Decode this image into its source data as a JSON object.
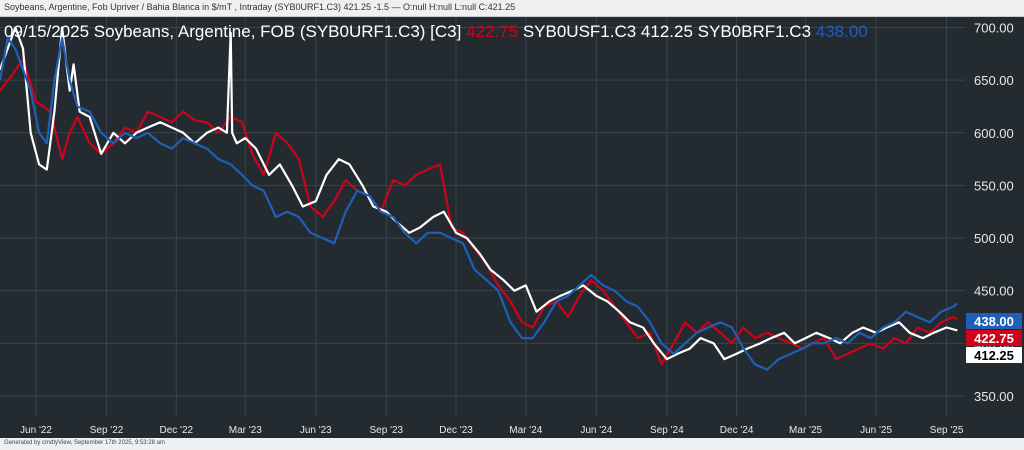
{
  "top_bar": {
    "text": "Soybeans, Argentine, Fob Upriver / Bahia Blanca in $/mT , Intraday (SYB0URF1.C3) 421.25 -1.5 — O:null H:null L:null C:421.25"
  },
  "footer": {
    "text": "Generated by cmdtyView, September 17th 2025, 9:53:28 am"
  },
  "colors": {
    "background": "#232b30",
    "red": "#d0021b",
    "white": "#ffffff",
    "blue": "#1f5fb8",
    "axis_text": "#e8e8e8",
    "grid": "#3a444b"
  },
  "chart_data": {
    "type": "line",
    "title": "09/15/2025 Soybeans, Argentine, FOB (SYB0URF1.C3) [C3]",
    "legend": [
      {
        "label": "422.75",
        "color": "#d0021b"
      },
      {
        "label": "SYB0USF1.C3 412.25",
        "color": "#ffffff"
      },
      {
        "label": "SYB0BRF1.C3",
        "color": "#ffffff"
      },
      {
        "label": "438.00",
        "color": "#1f5fb8"
      }
    ],
    "x_ticks": [
      "Jun '22",
      "Sep '22",
      "Dec '22",
      "Mar '23",
      "Jun '23",
      "Sep '23",
      "Dec '23",
      "Mar '24",
      "Jun '24",
      "Sep '24",
      "Dec '24",
      "Mar '25",
      "Jun '25",
      "Sep '25"
    ],
    "y_ticks": [
      350,
      400,
      450,
      500,
      550,
      600,
      650,
      700
    ],
    "ylim": [
      330,
      710
    ],
    "xlim": [
      "2022-04-15",
      "2025-09-25"
    ],
    "end_labels": [
      {
        "label": "438.00",
        "value": 438.0,
        "color": "#1f5fb8",
        "text_color": "#ffffff"
      },
      {
        "label": "422.75",
        "value": 422.75,
        "color": "#d0021b",
        "text_color": "#ffffff"
      },
      {
        "label": "412.25",
        "value": 412.25,
        "color": "#ffffff",
        "text_color": "#000000"
      }
    ],
    "series": [
      {
        "color": "#d0021b",
        "x": [
          "2022-04-15",
          "2022-05-01",
          "2022-05-15",
          "2022-06-01",
          "2022-06-20",
          "2022-07-05",
          "2022-07-15",
          "2022-07-25",
          "2022-08-10",
          "2022-08-25",
          "2022-09-10",
          "2022-09-25",
          "2022-10-10",
          "2022-10-25",
          "2022-11-10",
          "2022-11-25",
          "2022-12-10",
          "2022-12-25",
          "2023-01-10",
          "2023-01-25",
          "2023-02-10",
          "2023-02-25",
          "2023-03-10",
          "2023-03-25",
          "2023-04-10",
          "2023-04-25",
          "2023-05-10",
          "2023-05-25",
          "2023-06-10",
          "2023-06-25",
          "2023-07-10",
          "2023-07-25",
          "2023-08-10",
          "2023-08-25",
          "2023-09-10",
          "2023-09-25",
          "2023-10-10",
          "2023-10-25",
          "2023-11-10",
          "2023-11-25",
          "2023-12-10",
          "2023-12-25",
          "2024-01-10",
          "2024-01-25",
          "2024-02-10",
          "2024-02-25",
          "2024-03-10",
          "2024-03-25",
          "2024-04-10",
          "2024-04-25",
          "2024-05-10",
          "2024-05-25",
          "2024-06-10",
          "2024-06-25",
          "2024-07-10",
          "2024-07-25",
          "2024-08-10",
          "2024-08-25",
          "2024-09-10",
          "2024-09-25",
          "2024-10-10",
          "2024-10-25",
          "2024-11-10",
          "2024-11-25",
          "2024-12-10",
          "2024-12-25",
          "2025-01-10",
          "2025-01-25",
          "2025-02-10",
          "2025-02-25",
          "2025-03-10",
          "2025-03-25",
          "2025-04-10",
          "2025-04-25",
          "2025-05-10",
          "2025-05-25",
          "2025-06-10",
          "2025-06-25",
          "2025-07-10",
          "2025-07-25",
          "2025-08-10",
          "2025-08-25",
          "2025-09-10",
          "2025-09-15"
        ],
        "y": [
          640,
          655,
          670,
          630,
          620,
          575,
          600,
          615,
          590,
          580,
          590,
          605,
          600,
          620,
          615,
          610,
          620,
          612,
          610,
          600,
          615,
          610,
          580,
          560,
          600,
          590,
          575,
          530,
          520,
          535,
          555,
          545,
          540,
          525,
          555,
          550,
          560,
          565,
          570,
          510,
          505,
          490,
          475,
          455,
          440,
          420,
          415,
          435,
          440,
          425,
          445,
          460,
          450,
          435,
          420,
          405,
          410,
          380,
          400,
          420,
          410,
          420,
          410,
          400,
          415,
          405,
          410,
          405,
          400,
          395,
          400,
          405,
          385,
          390,
          395,
          400,
          395,
          405,
          400,
          415,
          410,
          420,
          425,
          422.75
        ]
      },
      {
        "color": "#ffffff",
        "x": [
          "2022-04-15",
          "2022-04-25",
          "2022-05-05",
          "2022-05-15",
          "2022-05-25",
          "2022-06-05",
          "2022-06-15",
          "2022-06-25",
          "2022-07-05",
          "2022-07-15",
          "2022-07-20",
          "2022-07-28",
          "2022-08-10",
          "2022-08-25",
          "2022-09-10",
          "2022-09-25",
          "2022-10-10",
          "2022-10-25",
          "2022-11-10",
          "2022-11-25",
          "2022-12-10",
          "2022-12-25",
          "2023-01-10",
          "2023-01-25",
          "2023-02-05",
          "2023-02-10",
          "2023-02-12",
          "2023-02-18",
          "2023-03-01",
          "2023-03-15",
          "2023-04-01",
          "2023-04-15",
          "2023-05-01",
          "2023-05-15",
          "2023-06-01",
          "2023-06-15",
          "2023-07-01",
          "2023-07-15",
          "2023-08-01",
          "2023-08-15",
          "2023-09-01",
          "2023-09-15",
          "2023-10-01",
          "2023-10-15",
          "2023-11-01",
          "2023-11-15",
          "2023-12-01",
          "2023-12-15",
          "2024-01-01",
          "2024-01-15",
          "2024-02-01",
          "2024-02-15",
          "2024-03-01",
          "2024-03-15",
          "2024-04-01",
          "2024-04-15",
          "2024-05-01",
          "2024-05-15",
          "2024-06-01",
          "2024-06-15",
          "2024-07-01",
          "2024-07-15",
          "2024-08-01",
          "2024-08-15",
          "2024-09-01",
          "2024-09-15",
          "2024-10-01",
          "2024-10-15",
          "2024-11-01",
          "2024-11-15",
          "2024-12-01",
          "2024-12-15",
          "2025-01-01",
          "2025-01-15",
          "2025-02-01",
          "2025-02-15",
          "2025-03-01",
          "2025-03-15",
          "2025-04-01",
          "2025-04-15",
          "2025-05-01",
          "2025-05-15",
          "2025-06-01",
          "2025-06-15",
          "2025-07-01",
          "2025-07-15",
          "2025-08-01",
          "2025-08-15",
          "2025-09-01",
          "2025-09-15"
        ],
        "y": [
          660,
          680,
          700,
          680,
          600,
          570,
          565,
          620,
          700,
          640,
          665,
          620,
          615,
          580,
          600,
          590,
          600,
          605,
          610,
          605,
          600,
          590,
          600,
          605,
          600,
          695,
          600,
          590,
          595,
          585,
          560,
          570,
          550,
          530,
          535,
          560,
          575,
          570,
          550,
          530,
          525,
          515,
          505,
          510,
          520,
          525,
          505,
          500,
          485,
          470,
          460,
          450,
          455,
          430,
          440,
          445,
          450,
          455,
          445,
          440,
          430,
          420,
          415,
          400,
          385,
          390,
          395,
          405,
          400,
          385,
          390,
          395,
          400,
          405,
          410,
          400,
          405,
          410,
          405,
          400,
          410,
          415,
          410,
          415,
          420,
          410,
          405,
          410,
          415,
          412.25
        ]
      },
      {
        "color": "#1f5fb8",
        "x": [
          "2022-04-15",
          "2022-04-25",
          "2022-05-05",
          "2022-05-15",
          "2022-05-25",
          "2022-06-05",
          "2022-06-15",
          "2022-06-25",
          "2022-07-05",
          "2022-07-15",
          "2022-07-25",
          "2022-08-10",
          "2022-08-25",
          "2022-09-10",
          "2022-09-25",
          "2022-10-10",
          "2022-10-25",
          "2022-11-10",
          "2022-11-25",
          "2022-12-10",
          "2022-12-25",
          "2023-01-10",
          "2023-01-25",
          "2023-02-10",
          "2023-02-25",
          "2023-03-10",
          "2023-03-25",
          "2023-04-10",
          "2023-04-25",
          "2023-05-10",
          "2023-05-25",
          "2023-06-10",
          "2023-06-25",
          "2023-07-10",
          "2023-07-25",
          "2023-08-10",
          "2023-08-25",
          "2023-09-10",
          "2023-09-25",
          "2023-10-10",
          "2023-10-25",
          "2023-11-10",
          "2023-11-25",
          "2023-12-10",
          "2023-12-25",
          "2024-01-10",
          "2024-01-25",
          "2024-02-10",
          "2024-02-25",
          "2024-03-10",
          "2024-03-25",
          "2024-04-10",
          "2024-04-25",
          "2024-05-10",
          "2024-05-25",
          "2024-06-10",
          "2024-06-25",
          "2024-07-10",
          "2024-07-25",
          "2024-08-10",
          "2024-08-25",
          "2024-09-10",
          "2024-09-25",
          "2024-10-10",
          "2024-10-25",
          "2024-11-10",
          "2024-11-25",
          "2024-12-10",
          "2024-12-25",
          "2025-01-10",
          "2025-01-25",
          "2025-02-10",
          "2025-02-25",
          "2025-03-10",
          "2025-03-25",
          "2025-04-10",
          "2025-04-25",
          "2025-05-10",
          "2025-05-25",
          "2025-06-10",
          "2025-06-25",
          "2025-07-10",
          "2025-07-25",
          "2025-08-10",
          "2025-08-25",
          "2025-09-10",
          "2025-09-15"
        ],
        "y": [
          650,
          690,
          680,
          660,
          640,
          600,
          590,
          650,
          690,
          650,
          625,
          620,
          600,
          590,
          600,
          595,
          600,
          590,
          585,
          595,
          590,
          585,
          575,
          570,
          560,
          550,
          545,
          520,
          525,
          520,
          505,
          500,
          495,
          525,
          545,
          540,
          525,
          520,
          505,
          495,
          505,
          505,
          500,
          495,
          470,
          460,
          450,
          420,
          405,
          405,
          420,
          440,
          445,
          455,
          465,
          455,
          450,
          440,
          435,
          420,
          400,
          390,
          400,
          410,
          415,
          420,
          415,
          395,
          380,
          375,
          385,
          390,
          395,
          400,
          400,
          405,
          400,
          410,
          405,
          415,
          420,
          430,
          425,
          420,
          430,
          435,
          438.0
        ]
      }
    ]
  }
}
